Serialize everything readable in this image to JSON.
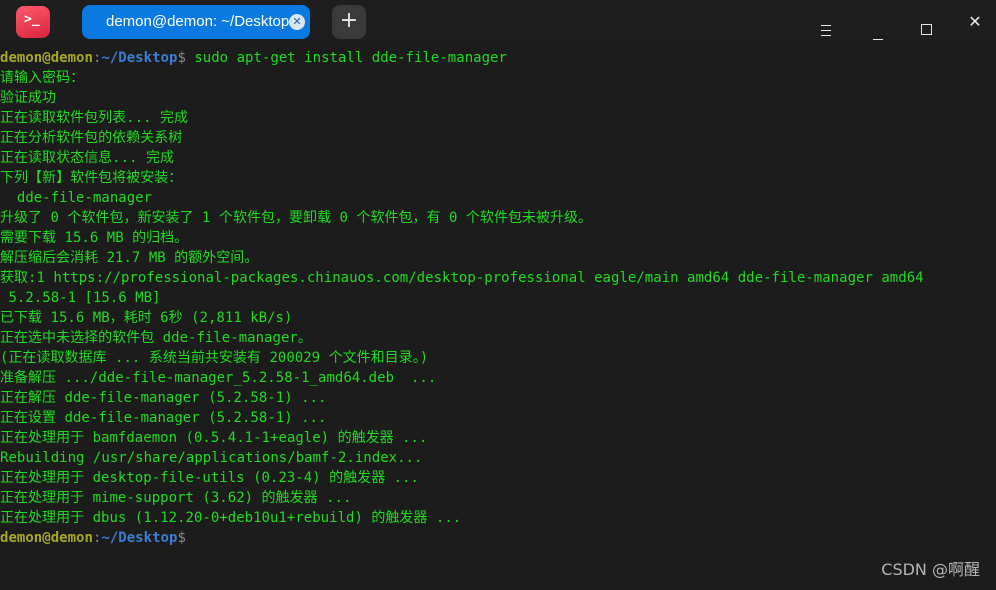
{
  "titlebar": {
    "app_icon": "terminal-icon",
    "tab_title": "demon@demon: ~/Desktop",
    "tab_close_icon": "close-icon",
    "new_tab_label": "+",
    "window_buttons": [
      "menu-icon",
      "minimize-icon",
      "maximize-icon",
      "close-icon"
    ]
  },
  "terminal": {
    "prompt": {
      "user": "demon@demon",
      "colon": ":",
      "path": "~/Desktop",
      "dollar": "$"
    },
    "command": " sudo apt-get install dde-file-manager",
    "output_lines": [
      "请输入密码：",
      "验证成功",
      "正在读取软件包列表... 完成",
      "正在分析软件包的依赖关系树",
      "正在读取状态信息... 完成",
      "下列【新】软件包将被安装：",
      "  dde-file-manager",
      "升级了 0 个软件包，新安装了 1 个软件包，要卸载 0 个软件包，有 0 个软件包未被升级。",
      "需要下载 15.6 MB 的归档。",
      "解压缩后会消耗 21.7 MB 的额外空间。",
      "获取:1 https://professional-packages.chinauos.com/desktop-professional eagle/main amd64 dde-file-manager amd64",
      " 5.2.58-1 [15.6 MB]",
      "已下载 15.6 MB，耗时 6秒 (2,811 kB/s)",
      "正在选中未选择的软件包 dde-file-manager。",
      "(正在读取数据库 ... 系统当前共安装有 200029 个文件和目录。)",
      "准备解压 .../dde-file-manager_5.2.58-1_amd64.deb  ...",
      "正在解压 dde-file-manager (5.2.58-1) ...",
      "正在设置 dde-file-manager (5.2.58-1) ...",
      "正在处理用于 bamfdaemon (0.5.4.1-1+eagle) 的触发器 ...",
      "Rebuilding /usr/share/applications/bamf-2.index...",
      "正在处理用于 desktop-file-utils (0.23-4) 的触发器 ...",
      "正在处理用于 mime-support (3.62) 的触发器 ...",
      "正在处理用于 dbus (1.12.20-0+deb10u1+rebuild) 的触发器 ..."
    ]
  },
  "watermark": "CSDN @啊醒"
}
